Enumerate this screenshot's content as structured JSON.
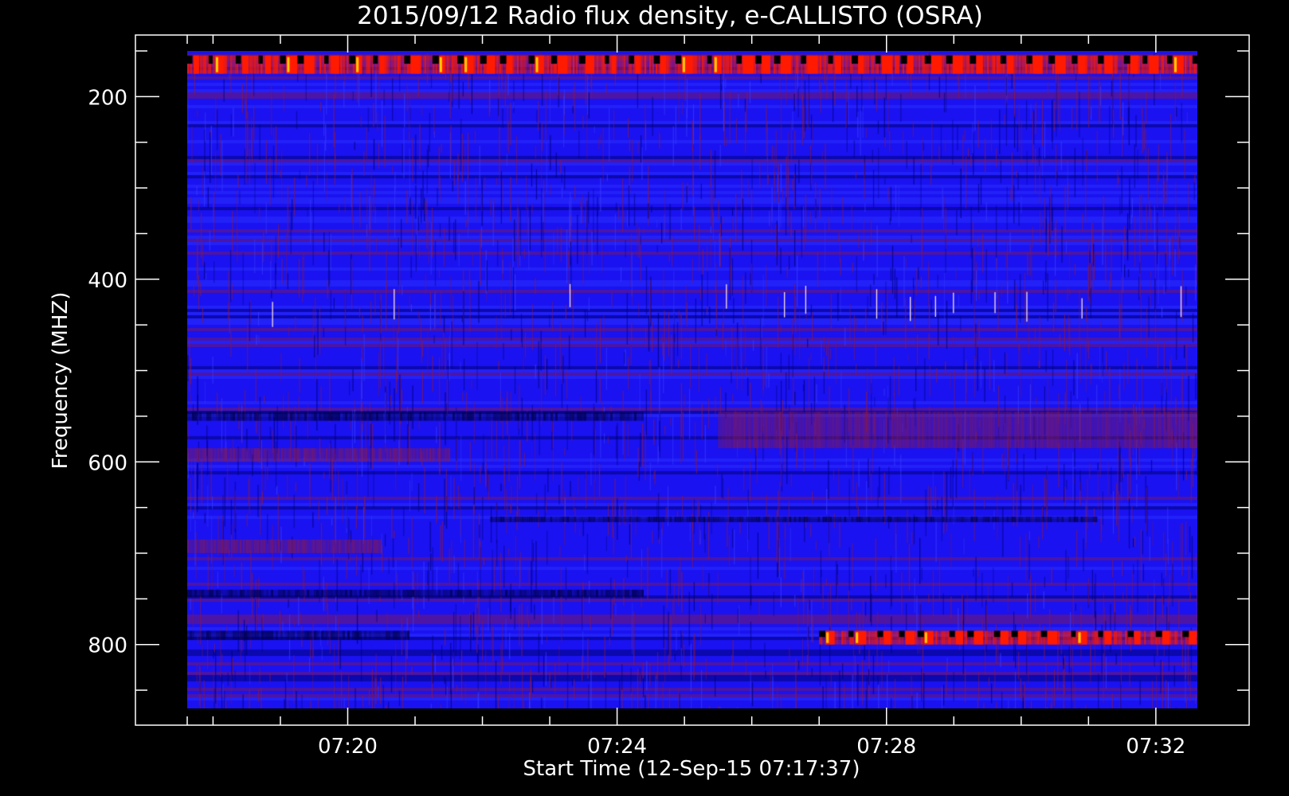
{
  "chart_data": {
    "type": "heatmap",
    "title": "2015/09/12  Radio flux density, e-CALLISTO (OSRA)",
    "xlabel": "Start Time (12-Sep-15 07:17:37)",
    "ylabel": "Frequency (MHZ)",
    "xlim": [
      "07:17:37",
      "07:32:37"
    ],
    "ylim": [
      150,
      870
    ],
    "y_inverted": true,
    "x_ticks": [
      "07:20",
      "07:24",
      "07:28",
      "07:32"
    ],
    "y_ticks": [
      200,
      400,
      600,
      800
    ],
    "colors": {
      "background": "#000000",
      "axes": "#ffffff",
      "spectrogram_base": "#1a12f0",
      "low_intensity": "#00007a",
      "mid_intensity": "#8a1a4a",
      "high_intensity": "#ff1a00",
      "peak_intensity": "#ffd000"
    },
    "features": [
      {
        "name": "top band interference",
        "freq_range": [
          155,
          175
        ],
        "time_range": [
          "07:17:37",
          "07:32:37"
        ],
        "level": "high"
      },
      {
        "name": "enhanced band",
        "freq_range": [
          585,
          600
        ],
        "time_range": [
          "07:17:37",
          "07:21:30"
        ],
        "level": "mid"
      },
      {
        "name": "enhanced band",
        "freq_range": [
          545,
          585
        ],
        "time_range": [
          "07:25:30",
          "07:32:37"
        ],
        "level": "mid"
      },
      {
        "name": "enhanced band",
        "freq_range": [
          685,
          700
        ],
        "time_range": [
          "07:17:37",
          "07:20:30"
        ],
        "level": "mid"
      },
      {
        "name": "emission band",
        "freq_range": [
          785,
          800
        ],
        "time_range": [
          "07:27:00",
          "07:32:37"
        ],
        "level": "high"
      }
    ]
  }
}
